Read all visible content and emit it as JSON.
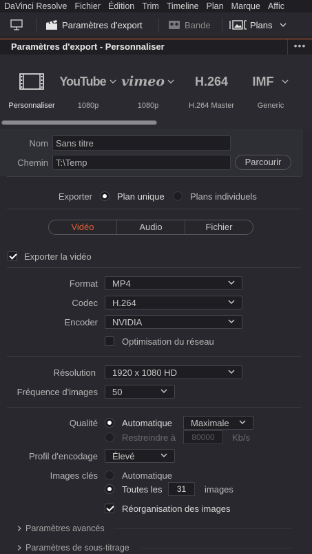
{
  "menu": [
    "DaVinci Resolve",
    "Fichier",
    "Édition",
    "Trim",
    "Timeline",
    "Plan",
    "Marque",
    "Affic"
  ],
  "toolbar": {
    "export_settings_label": "Paramètres d'export",
    "band_label": "Bande",
    "clips_label": "Plans"
  },
  "panel": {
    "title": "Paramètres d'export - Personnaliser",
    "more": "•••"
  },
  "presets": [
    {
      "name": "custom",
      "label": "Personnaliser",
      "icon": "film-strip-icon",
      "selected": true
    },
    {
      "name": "youtube",
      "label": "1080p",
      "logo": "YouTube"
    },
    {
      "name": "vimeo",
      "label": "1080p",
      "logo": "vimeo"
    },
    {
      "name": "h264",
      "label": "H.264 Master",
      "logo": "H.264"
    },
    {
      "name": "imf",
      "label": "Generic",
      "logo": "IMF"
    }
  ],
  "file": {
    "name_label": "Nom",
    "name_value": "Sans titre",
    "path_label": "Chemin",
    "path_value": "T:\\Temp",
    "browse_label": "Parcourir"
  },
  "export": {
    "label": "Exporter",
    "single_clip": "Plan unique",
    "individual_clips": "Plans individuels",
    "selected": "single_clip"
  },
  "tabs": {
    "video": "Vidéo",
    "audio": "Audio",
    "file": "Fichier",
    "active": "video"
  },
  "video": {
    "export_video_label": "Exporter la vidéo",
    "export_video_checked": true,
    "format_label": "Format",
    "format_value": "MP4",
    "codec_label": "Codec",
    "codec_value": "H.264",
    "encoder_label": "Encoder",
    "encoder_value": "NVIDIA",
    "network_opt_label": "Optimisation du réseau",
    "network_opt_checked": false,
    "resolution_label": "Résolution",
    "resolution_value": "1920 x 1080 HD",
    "framerate_label": "Fréquence d'images",
    "framerate_value": "50",
    "quality_label": "Qualité",
    "quality_auto_label": "Automatique",
    "quality_auto_value": "Maximale",
    "quality_restrict_label": "Restreindre à",
    "quality_restrict_value": "80000",
    "quality_restrict_unit": "Kb/s",
    "profile_label": "Profil d'encodage",
    "profile_value": "Élevé",
    "keyframes_label": "Images clés",
    "keyframes_auto_label": "Automatique",
    "keyframes_every_label": "Toutes les",
    "keyframes_every_value": "31",
    "keyframes_unit": "images",
    "reorder_label": "Réorganisation des images",
    "reorder_checked": true
  },
  "sections": {
    "advanced": "Paramètres avancés",
    "subtitles": "Paramètres de sous-titrage"
  },
  "colors": {
    "accent": "#e0603a",
    "panel_header_border": "#c85a2a"
  }
}
